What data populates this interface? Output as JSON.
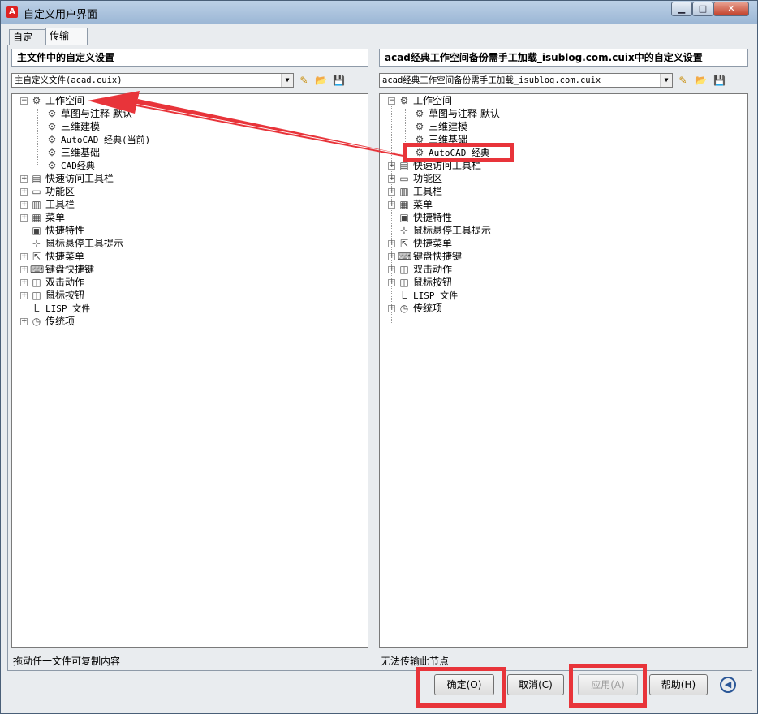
{
  "window": {
    "title": "自定义用户界面",
    "minimize": "▁",
    "maximize": "□",
    "close": "✕"
  },
  "tabs": [
    "自定义",
    "传输"
  ],
  "left": {
    "header": "主文件中的自定义设置",
    "file_combo": "主自定义文件(acad.cuix)",
    "status": "拖动任一文件可复制内容",
    "tree": {
      "root": "工作空间",
      "workspaces": [
        "草图与注释 默认",
        "三维建模",
        "AutoCAD 经典(当前)",
        "三维基础",
        "CAD经典"
      ],
      "items": [
        "快速访问工具栏",
        "功能区",
        "工具栏",
        "菜单",
        "快捷特性",
        "鼠标悬停工具提示",
        "快捷菜单",
        "键盘快捷键",
        "双击动作",
        "鼠标按钮",
        "LISP 文件",
        "传统项"
      ]
    }
  },
  "right": {
    "header": "acad经典工作空间备份需手工加载_isublog.com.cuix中的自定义设置",
    "file_combo": "acad经典工作空间备份需手工加载_isublog.com.cuix",
    "status": "无法传输此节点",
    "tree": {
      "root": "工作空间",
      "workspaces": [
        "草图与注释 默认",
        "三维建模",
        "三维基础",
        "AutoCAD 经典"
      ],
      "items": [
        "快速访问工具栏",
        "功能区",
        "工具栏",
        "菜单",
        "快捷特性",
        "鼠标悬停工具提示",
        "快捷菜单",
        "键盘快捷键",
        "双击动作",
        "鼠标按钮",
        "LISP 文件",
        "传统项"
      ]
    }
  },
  "buttons": {
    "ok": "确定(O)",
    "cancel": "取消(C)",
    "apply": "应用(A)",
    "help": "帮助(H)"
  },
  "icons": {
    "new_file": "✎",
    "open_file": "📂",
    "save_file": "💾",
    "gear": "⚙",
    "folder": "▭",
    "lisp": "L",
    "history": "◷",
    "back": "◀"
  },
  "colors": {
    "annotation_red": "#e8343a",
    "titlebar": "#9cb7d5"
  }
}
